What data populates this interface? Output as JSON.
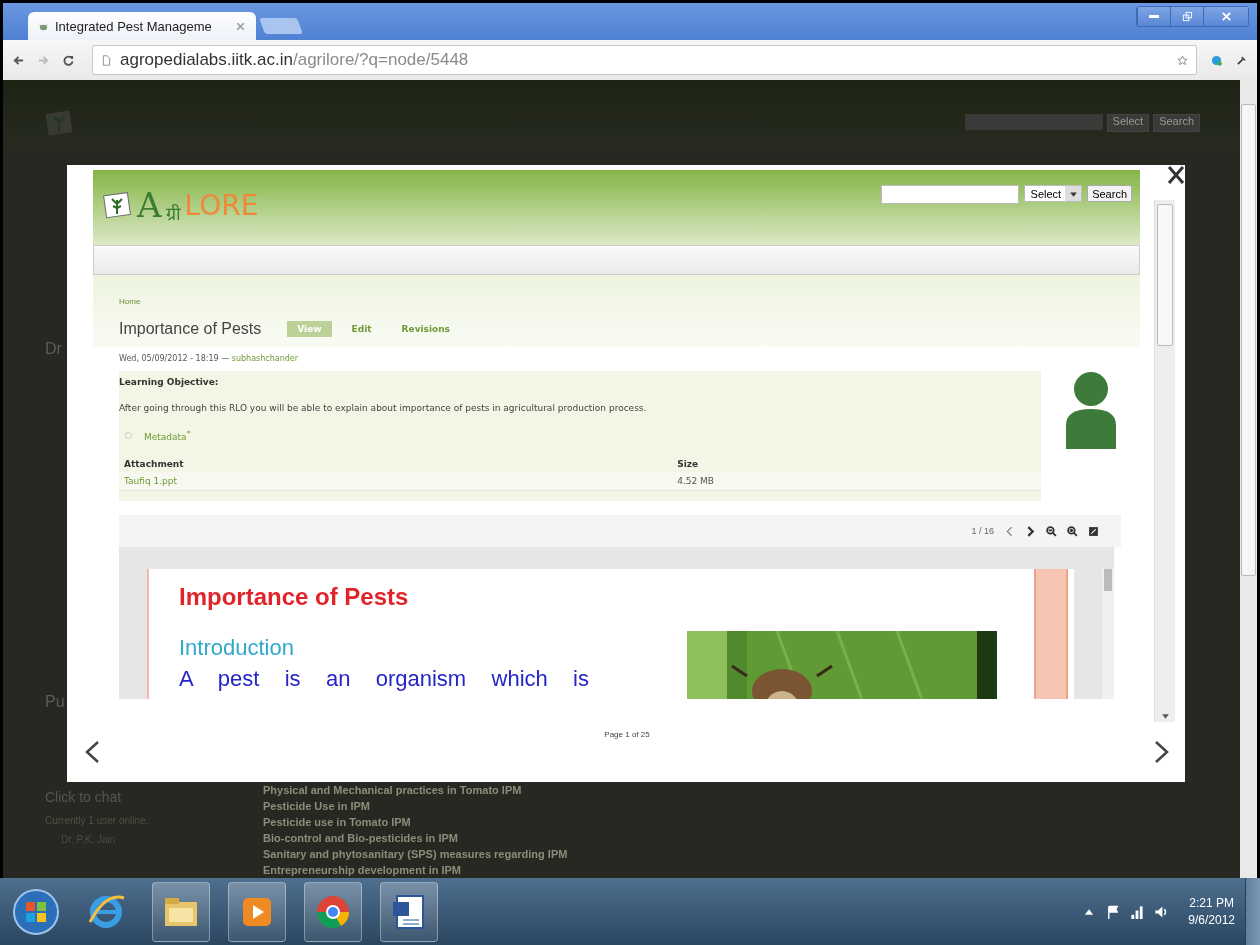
{
  "browser": {
    "tab_title": "Integrated Pest Manageme",
    "url_host": "agropedialabs.iitk.ac.in",
    "url_path": "/agrilore/?q=node/5448"
  },
  "background_page": {
    "search_select": "Select",
    "search_button": "Search",
    "side_texts": [
      "Dr",
      "Pu"
    ],
    "chat_link": "Click to chat",
    "online": "Currently 1 user online.",
    "online_users": [
      "Dr. P.K. Jain"
    ],
    "list_items": [
      "Physical and Mechanical practices in Tomato IPM",
      "Pesticide Use in IPM",
      "Pesticide use in Tomato IPM",
      "Bio-control and Bio-pesticides in IPM",
      "Sanitary and phytosanitary (SPS) measures regarding IPM",
      "Entrepreneurship development in IPM"
    ]
  },
  "modal": {
    "logo_parts": [
      "A",
      "ग्री",
      "LORE"
    ],
    "search": {
      "select": "Select",
      "button": "Search"
    },
    "breadcrumb": "Home",
    "title": "Importance of Pests",
    "tabs": [
      {
        "label": "View",
        "selected": true
      },
      {
        "label": "Edit",
        "selected": false
      },
      {
        "label": "Revisions",
        "selected": false
      }
    ],
    "submitted": {
      "date": "Wed, 05/09/2012 - 18:19 —",
      "author": "subhashchander"
    },
    "objective_heading": "Learning Objective:",
    "objective_text": "After going through this RLO you will be able to explain about importance of pests in agricultural production process.",
    "metadata_link": "Metadata$^{*}$",
    "table": {
      "columns": [
        "Attachment",
        "Size"
      ],
      "rows": [
        [
          "Taufiq 1.ppt",
          "4.52 MB"
        ]
      ]
    },
    "viewer": {
      "page_counter": "1 / 16",
      "slide": {
        "title": "Importance of Pests",
        "subtitle": "Introduction",
        "body": "A pest is an organism which is"
      }
    },
    "pager": "Page 1 of 25"
  },
  "taskbar": {
    "time": "2:21 PM",
    "date": "9/6/2012"
  }
}
